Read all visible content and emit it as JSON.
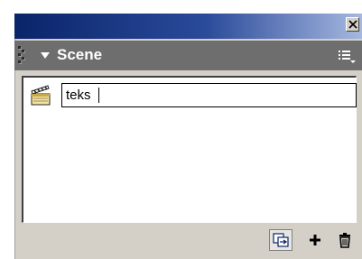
{
  "panel": {
    "title": "Scene"
  },
  "titlebar": {
    "close_icon": "close-icon"
  },
  "header_icons": {
    "collapse": "triangle-down-icon",
    "options": "panel-options-menu-icon"
  },
  "scenes": [
    {
      "icon": "clapperboard-icon",
      "name": "teks",
      "editing": true
    }
  ],
  "toolbar": {
    "duplicate_icon": "duplicate-scene-icon",
    "add_icon": "plus-icon",
    "delete_icon": "trash-icon"
  },
  "colors": {
    "title_gradient_start": "#0a246a",
    "title_gradient_end": "#a6b8e0",
    "header_bg": "#6e6e6e",
    "panel_bg": "#d4d0c8"
  }
}
